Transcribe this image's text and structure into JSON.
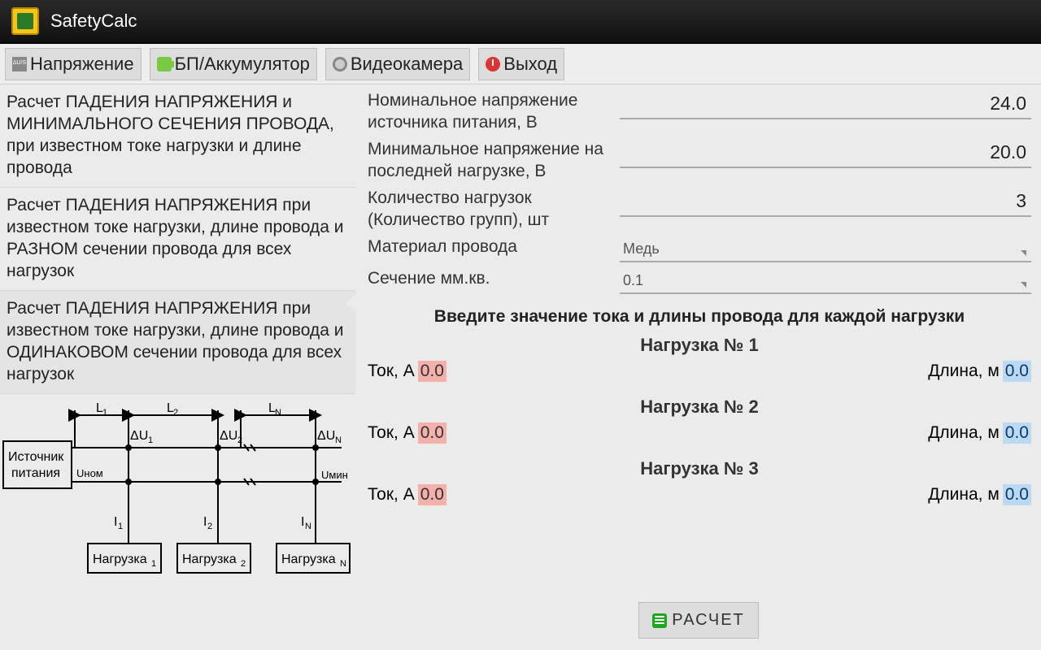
{
  "app": {
    "title": "SafetyCalc"
  },
  "toolbar": {
    "voltage": "Напряжение",
    "battery": "БП/Аккумулятор",
    "camera": "Видеокамера",
    "exit": "Выход"
  },
  "options": {
    "opt1": "Расчет ПАДЕНИЯ НАПРЯЖЕНИЯ и МИНИМАЛЬНОГО СЕЧЕНИЯ ПРОВОДА, при известном токе нагрузки и длине провода",
    "opt2": "Расчет ПАДЕНИЯ НАПРЯЖЕНИЯ при известном токе нагрузки, длине провода и РАЗНОМ сечении провода для всех нагрузок",
    "opt3": "Расчет ПАДЕНИЯ НАПРЯЖЕНИЯ при известном токе нагрузки, длине провода и ОДИНАКОВОМ сечении провода для всех нагрузок"
  },
  "diagram": {
    "source": "Источник питания",
    "unom": "Uном",
    "umin": "Uмин",
    "l1": "L",
    "l2": "L",
    "ln": "L",
    "du1": "ΔU",
    "du2": "ΔU",
    "dun": "ΔU",
    "i1": "I",
    "i2": "I",
    "in": "I",
    "load": "Нагрузка"
  },
  "params": {
    "nominal_label": "Номинальное напряжение источника питания, В",
    "nominal_value": "24.0",
    "min_label": "Минимальное напряжение на последней нагрузке, В",
    "min_value": "20.0",
    "count_label": "Количество нагрузок (Количество групп), шт",
    "count_value": "3",
    "material_label": "Материал провода",
    "material_value": "Медь",
    "section_label": "Сечение мм.кв.",
    "section_value": "0.1"
  },
  "loads": {
    "instruction": "Введите значение тока и длины провода для каждой нагрузки",
    "current_label": "Ток, А",
    "length_label": "Длина, м",
    "h1": "Нагрузка № 1",
    "h2": "Нагрузка № 2",
    "h3": "Нагрузка № 3",
    "cur1": "0.0",
    "len1": "0.0",
    "cur2": "0.0",
    "len2": "0.0",
    "cur3": "0.0",
    "len3": "0.0"
  },
  "calc_button": "РАСЧЕТ"
}
